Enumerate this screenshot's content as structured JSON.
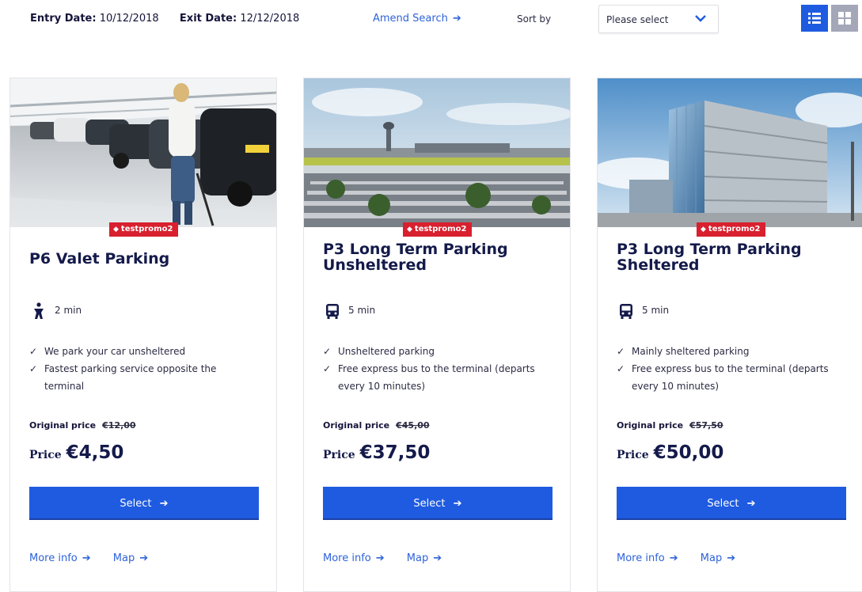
{
  "header": {
    "entry_label": "Entry Date:",
    "entry_value": "10/12/2018",
    "exit_label": "Exit Date:",
    "exit_value": "12/12/2018",
    "amend_search": "Amend Search",
    "sort_label": "Sort by",
    "sort_value": "Please select",
    "arrow": "➔",
    "active_view": "list",
    "icons": [
      "list-view-icon",
      "grid-view-icon",
      "chevron-down-icon"
    ]
  },
  "colors": {
    "accent": "#1e5be0",
    "link": "#2e63d9",
    "promo": "#d8202e",
    "title": "#141a4a"
  },
  "cards": [
    {
      "promo": "testpromo2",
      "title": "P6 Valet Parking",
      "transport_icon": "walking-person-icon",
      "transport_time": "2 min",
      "features": [
        "We park your car unsheltered",
        "Fastest parking service opposite the terminal"
      ],
      "original_label": "Original price",
      "original_price": "€12,00",
      "price_label": "Price",
      "price": "€4,50",
      "select_label": "Select",
      "more_info": "More info",
      "map": "Map"
    },
    {
      "promo": "testpromo2",
      "title": "P3 Long Term Parking Unsheltered",
      "transport_icon": "bus-icon",
      "transport_time": "5 min",
      "features": [
        "Unsheltered parking",
        "Free express bus to the terminal (departs every 10 minutes)"
      ],
      "original_label": "Original price",
      "original_price": "€45,00",
      "price_label": "Price",
      "price": "€37,50",
      "select_label": "Select",
      "more_info": "More info",
      "map": "Map"
    },
    {
      "promo": "testpromo2",
      "title": "P3 Long Term Parking Sheltered",
      "transport_icon": "bus-icon",
      "transport_time": "5 min",
      "features": [
        "Mainly sheltered parking",
        "Free express bus to the terminal (departs every 10 minutes)"
      ],
      "original_label": "Original price",
      "original_price": "€57,50",
      "price_label": "Price",
      "price": "€50,00",
      "select_label": "Select",
      "more_info": "More info",
      "map": "Map"
    }
  ]
}
